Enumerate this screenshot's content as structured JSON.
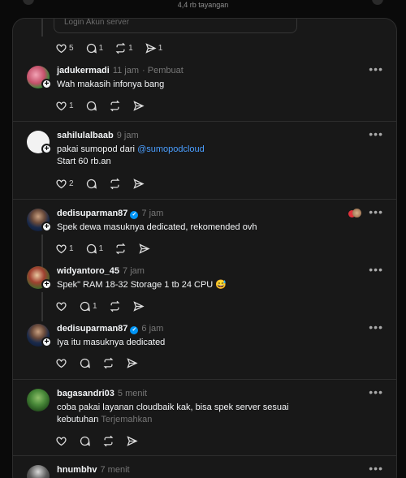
{
  "header": {
    "views": "4,4 rb tayangan"
  },
  "quoted_post_cut": {
    "text": "Login Akun server"
  },
  "comments": [
    {
      "actions": {
        "like": "5",
        "reply": "1",
        "repost": "1",
        "share": "1"
      }
    },
    {
      "username": "jadukermadi",
      "time": "11 jam",
      "badge": "· Pembuat",
      "text": "Wah makasih infonya bang",
      "actions": {
        "like": "1",
        "reply": "",
        "repost": "",
        "share": ""
      }
    },
    {
      "username": "sahilulalbaab",
      "time": "9 jam",
      "text_prefix": "pakai sumopod dari ",
      "mention": "@sumopodcloud",
      "text_line2": "Start 60 rb.an",
      "actions": {
        "like": "2",
        "reply": "",
        "repost": "",
        "share": ""
      }
    },
    {
      "username": "dedisuparman87",
      "time": "7 jam",
      "text": "Spek dewa masuknya dedicated, rekomended ovh",
      "actions": {
        "like": "1",
        "reply": "1",
        "repost": "",
        "share": ""
      }
    },
    {
      "username": "widyantoro_45",
      "time": "7 jam",
      "text": "Spek\" RAM 18-32 Storage 1 tb 24 CPU 😅",
      "actions": {
        "like": "",
        "reply": "1",
        "repost": "",
        "share": ""
      }
    },
    {
      "username": "dedisuparman87",
      "time": "6 jam",
      "text": "Iya itu masuknya dedicated",
      "actions": {
        "like": "",
        "reply": "",
        "repost": "",
        "share": ""
      }
    },
    {
      "username": "bagasandri03",
      "time": "5 menit",
      "text": "coba pakai layanan cloudbaik kak, bisa spek server sesuai kebutuhan",
      "translate": "Terjemahkan",
      "actions": {
        "like": "",
        "reply": "",
        "repost": "",
        "share": ""
      }
    },
    {
      "username": "hnumbhv",
      "time": "7 menit"
    }
  ],
  "icons": {
    "like": "heart-icon",
    "reply": "comment-icon",
    "repost": "repost-icon",
    "share": "share-icon",
    "more": "more-icon"
  },
  "colors": {
    "background": "#181818",
    "mention": "#4a9eff",
    "verified": "#0095f6"
  }
}
